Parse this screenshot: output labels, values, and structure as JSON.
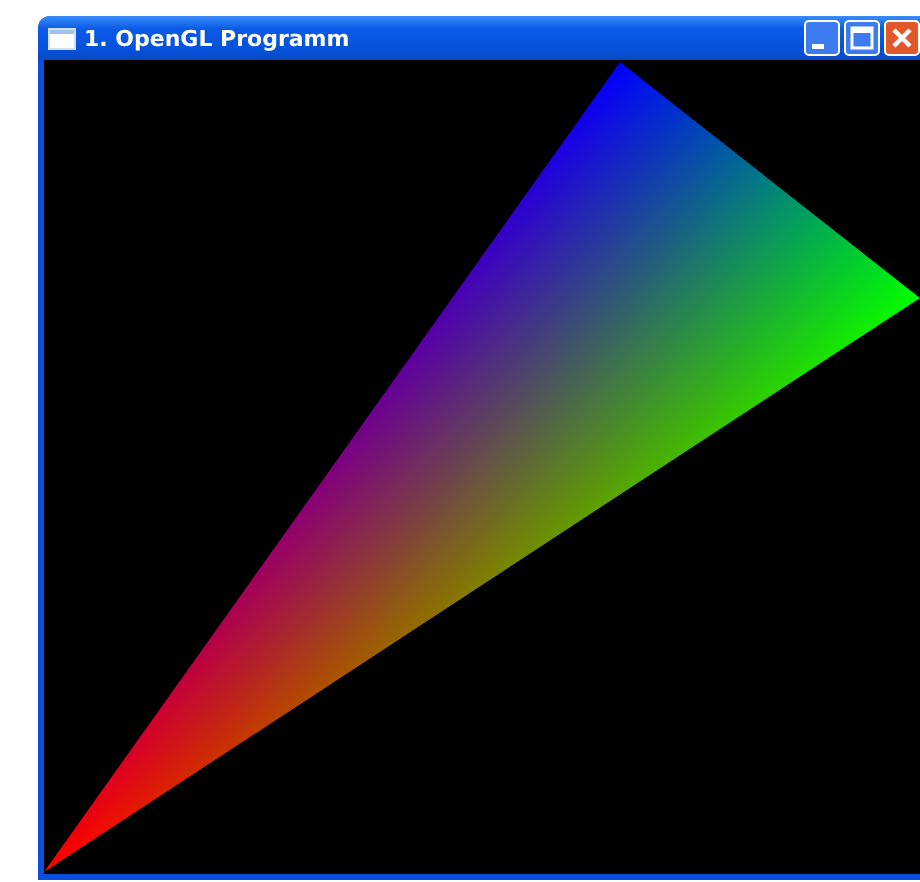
{
  "window": {
    "title": "1. OpenGL Programm"
  }
}
